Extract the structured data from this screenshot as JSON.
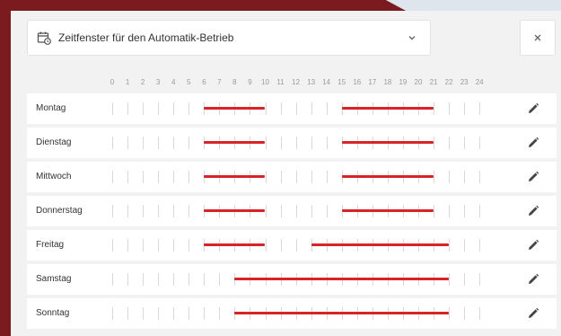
{
  "dialog": {
    "title": "Zeitfenster für den Automatik-Betrieb",
    "icons": {
      "title": "calendar-clock-icon",
      "dropdown": "chevron-down-icon",
      "close": "close-icon",
      "edit": "pencil-icon"
    }
  },
  "colors": {
    "accent": "#d8232a",
    "brand_bg": "#7b1a1f"
  },
  "hours": [
    "0",
    "1",
    "2",
    "3",
    "4",
    "5",
    "6",
    "7",
    "8",
    "9",
    "10",
    "11",
    "12",
    "13",
    "14",
    "15",
    "16",
    "17",
    "18",
    "19",
    "20",
    "21",
    "22",
    "23",
    "24"
  ],
  "schedule": [
    {
      "day": "Montag",
      "windows": [
        [
          6,
          10
        ],
        [
          15,
          21
        ]
      ]
    },
    {
      "day": "Dienstag",
      "windows": [
        [
          6,
          10
        ],
        [
          15,
          21
        ]
      ]
    },
    {
      "day": "Mittwoch",
      "windows": [
        [
          6,
          10
        ],
        [
          15,
          21
        ]
      ]
    },
    {
      "day": "Donnerstag",
      "windows": [
        [
          6,
          10
        ],
        [
          15,
          21
        ]
      ]
    },
    {
      "day": "Freitag",
      "windows": [
        [
          6,
          10
        ],
        [
          13,
          22
        ]
      ]
    },
    {
      "day": "Samstag",
      "windows": [
        [
          8,
          22
        ]
      ]
    },
    {
      "day": "Sonntag",
      "windows": [
        [
          8,
          22
        ]
      ]
    }
  ]
}
